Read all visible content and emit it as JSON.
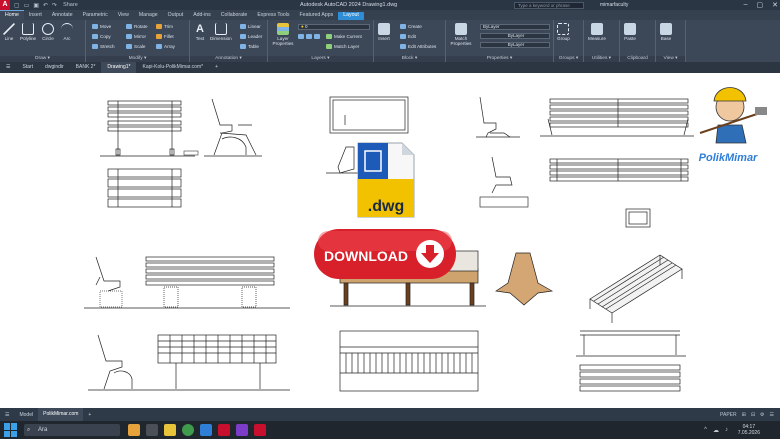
{
  "app": {
    "title": "Autodesk AutoCAD 2024   Drawing1.dwg",
    "logo": "A",
    "share": "Share",
    "search_placeholder": "Type a keyword or phrase",
    "user": "mimarfaculty",
    "window_controls": [
      "–",
      "▢",
      "✕"
    ]
  },
  "ribbon_tabs": [
    "Home",
    "Insert",
    "Annotate",
    "Parametric",
    "View",
    "Manage",
    "Output",
    "Add-ins",
    "Collaborate",
    "Express Tools",
    "Featured Apps",
    "Layout"
  ],
  "ribbon": {
    "draw": {
      "title": "Draw ▾",
      "tools": [
        "Line",
        "Polyline",
        "Circle",
        "Arc"
      ]
    },
    "modify": {
      "title": "Modify ▾",
      "items": [
        "Move",
        "Rotate",
        "Trim",
        "Copy",
        "Mirror",
        "Fillet",
        "Stretch",
        "Scale",
        "Array"
      ]
    },
    "annotation": {
      "title": "Annotation ▾",
      "tools": [
        "Text",
        "Dimension"
      ],
      "items": [
        "Linear",
        "Leader",
        "Table"
      ]
    },
    "layers": {
      "title": "Layers ▾",
      "tools": [
        "Layer Properties"
      ],
      "items": [
        "Make Current",
        "Match Layer"
      ],
      "layer_value": "0"
    },
    "block": {
      "title": "Block ▾",
      "tools": [
        "Insert"
      ],
      "items": [
        "Create",
        "Edit",
        "Edit Attributes"
      ]
    },
    "properties": {
      "title": "Properties ▾",
      "tools": [
        "Match Properties"
      ],
      "combos": [
        "ByLayer",
        "ByLayer",
        "ByLayer"
      ]
    },
    "groups": {
      "title": "Groups ▾",
      "tools": [
        "Group"
      ]
    },
    "utilities": {
      "title": "Utilities ▾",
      "tools": [
        "Measure"
      ]
    },
    "clipboard": {
      "title": "Clipboard",
      "tools": [
        "Paste"
      ]
    },
    "view": {
      "title": "View ▾",
      "tools": [
        "Base"
      ]
    }
  },
  "doc_tabs": [
    "Start",
    "dwgindir",
    "BANK 2*",
    "Drawing1*",
    "Kapi-Kolu-PolikMimar.com*",
    "+"
  ],
  "canvas": {
    "dwg_label": ".dwg",
    "download_label": "DOWNLOAD",
    "watermark": "PolikMimar"
  },
  "status_tabs": [
    "Model",
    "PolikMimar.com",
    "+"
  ],
  "status_right": [
    "PAPER",
    "⊞",
    "⊟",
    "⚙",
    "☰"
  ],
  "taskbar": {
    "search_text": "Ara",
    "time": "04:17",
    "date": "7.05.2026",
    "tray": [
      "^",
      "☁",
      "♪"
    ]
  },
  "colors": {
    "ribbon_bg": "#3c4757",
    "layout_tab": "#2f8dd6",
    "download_red": "#d8202a",
    "dwg_yellow": "#f2c200",
    "dwg_blue": "#1e5bb8"
  }
}
